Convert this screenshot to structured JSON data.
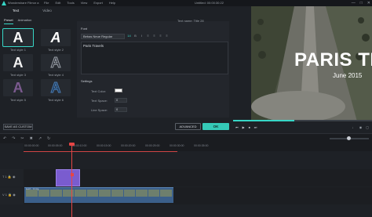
{
  "titlebar": {
    "app_name": "Wondershare Filmor​ a",
    "menu": [
      "File",
      "Edit",
      "Tools",
      "View",
      "Export",
      "Help"
    ],
    "document": "Untitled: 00:00:30:22",
    "window_controls": [
      "—",
      "□",
      "✕"
    ]
  },
  "panel_tabs": [
    "Text",
    "Video"
  ],
  "subtabs": [
    "Preset",
    "Animation"
  ],
  "styles": [
    {
      "label": "Text style 1",
      "glyph": "A",
      "color": "#ffffff"
    },
    {
      "label": "Text style 2",
      "glyph": "A",
      "color": "#ffffff"
    },
    {
      "label": "Text style 3",
      "glyph": "A",
      "color": "#f2f2f2"
    },
    {
      "label": "Text style 4",
      "glyph": "A",
      "color": "#2b2f36"
    },
    {
      "label": "Text style 5",
      "glyph": "A",
      "color": "#7b5a8f"
    },
    {
      "label": "Text style 6",
      "glyph": "A",
      "color": "#1d3a5a"
    }
  ],
  "save_custom_label": "SAVE AS CUSTOM",
  "editor": {
    "text_name": "Text name: Title 28",
    "font_section": "Font",
    "font_name": "Bebas Neue Regular",
    "font_size": "14",
    "format_buttons": [
      "B",
      "I",
      "≡",
      "≡",
      "≡",
      "≡"
    ],
    "text_content": "Paris Travels",
    "settings_section": "Settings",
    "text_color_label": "Text Color:",
    "text_space_label": "Text Space:",
    "text_space_value": "0",
    "line_space_label": "Line Space:",
    "line_space_value": "0"
  },
  "buttons": {
    "advanced": "ADVANCED",
    "ok": "OK"
  },
  "preview": {
    "title": "PARIS TRAV",
    "subtitle": "June 2015",
    "progress": 0.44
  },
  "player_controls": [
    "⏮",
    "▶",
    "⏹",
    "⏭"
  ],
  "timeline": {
    "ruler_ticks": [
      "00:00:00:00",
      "00:00:05:00",
      "00:00:10:00",
      "00:00:15:00",
      "00:00:20:00",
      "00:00:25:00",
      "00:00:30:00",
      "00:00:35:00"
    ],
    "tools": [
      "↶",
      "↷",
      "✂",
      "✖",
      "↗",
      "↻"
    ],
    "tracks": [
      {
        "label": "T 1",
        "kind": "title"
      },
      {
        "label": "V 1",
        "kind": "video"
      }
    ],
    "video_clip_label": "IMG_2015"
  },
  "colors": {
    "accent": "#37d6c6",
    "title_clip": "#7a5ccf",
    "video_clip": "#3b5f8a",
    "playhead": "#e64545"
  }
}
